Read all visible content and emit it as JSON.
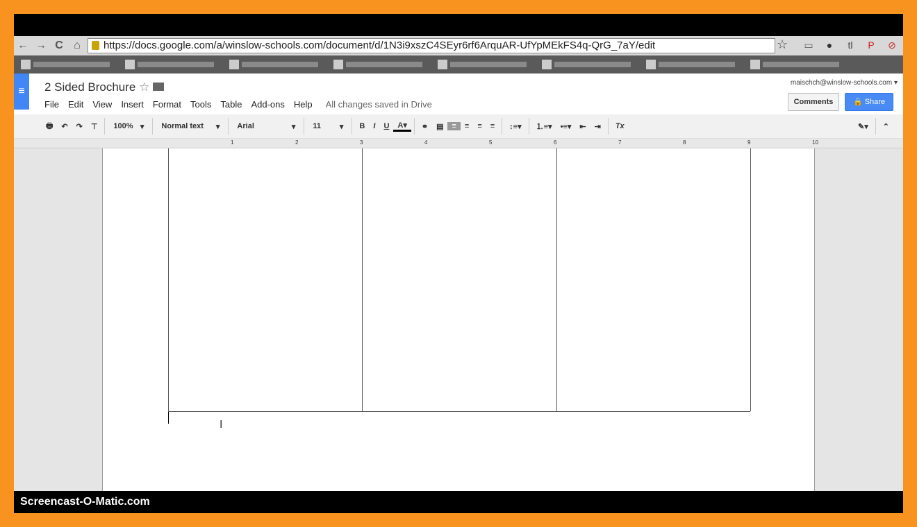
{
  "browser": {
    "url": "https://docs.google.com/a/winslow-schools.com/document/d/1N3i9xszC4SEyr6rf6ArquAR-UfYpMEkFS4q-QrG_7aY/edit",
    "nav": [
      "←",
      "→",
      "C",
      "⌂"
    ],
    "extensions": [
      {
        "icon": "cast-icon",
        "glyph": "▭",
        "color": "#666"
      },
      {
        "icon": "chrome-ext-icon",
        "glyph": "●",
        "color": "#333"
      },
      {
        "icon": "tldr-icon",
        "glyph": "tl",
        "color": "#444"
      },
      {
        "icon": "pinterest-icon",
        "glyph": "P",
        "color": "#cb2027"
      },
      {
        "icon": "ext-red-icon",
        "glyph": "⊘",
        "color": "#c62828"
      }
    ]
  },
  "docs": {
    "title": "2 Sided Brochure",
    "menus": [
      "File",
      "Edit",
      "View",
      "Insert",
      "Format",
      "Tools",
      "Table",
      "Add-ons",
      "Help"
    ],
    "save_status": "All changes saved in Drive",
    "email": "maischch@winslow-schools.com",
    "comments_label": "Comments",
    "share_label": "Share",
    "accent": "#4285f4"
  },
  "toolbar": {
    "zoom": "100%",
    "style": "Normal text",
    "font": "Arial",
    "size": "11"
  },
  "ruler": [
    "1",
    "2",
    "3",
    "4",
    "5",
    "6",
    "7",
    "8",
    "9",
    "10"
  ],
  "watermark": "Screencast-O-Matic.com"
}
